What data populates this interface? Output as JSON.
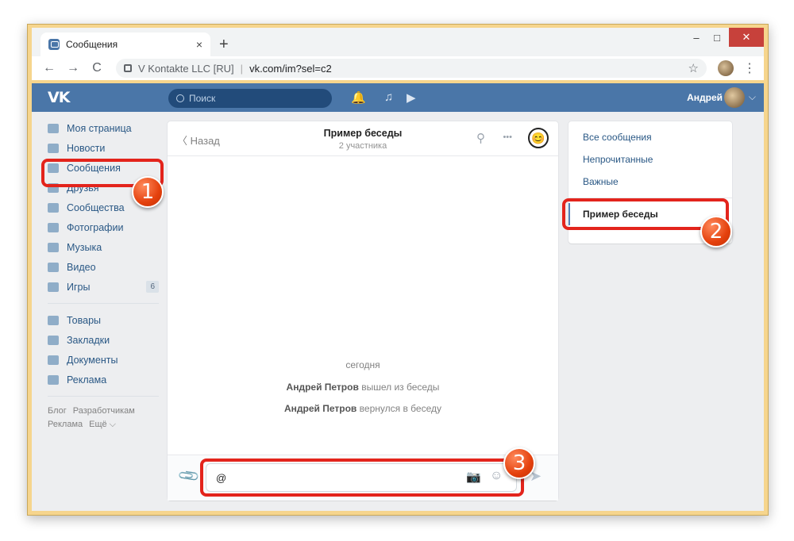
{
  "browser": {
    "tab_title": "Сообщения",
    "tab_close": "×",
    "new_tab": "+",
    "win_min": "–",
    "win_max": "□",
    "win_close": "✕",
    "back": "←",
    "forward": "→",
    "reload": "C",
    "site_name": "V Kontakte LLC [RU]",
    "url": "vk.com/im?sel=c2",
    "star": "☆",
    "menu": "⋮"
  },
  "vk_header": {
    "logo": "VK",
    "search_placeholder": "Поиск",
    "user_name": "Андрей",
    "bell": "🔔",
    "music": "♫",
    "play": "▶",
    "chevron": "⌵"
  },
  "left_nav": {
    "items": [
      {
        "label": "Моя страница"
      },
      {
        "label": "Новости"
      },
      {
        "label": "Сообщения"
      },
      {
        "label": "Друзья"
      },
      {
        "label": "Сообщества"
      },
      {
        "label": "Фотографии"
      },
      {
        "label": "Музыка"
      },
      {
        "label": "Видео"
      },
      {
        "label": "Игры",
        "badge": "6"
      }
    ],
    "items2": [
      {
        "label": "Товары"
      },
      {
        "label": "Закладки"
      },
      {
        "label": "Документы"
      },
      {
        "label": "Реклама"
      }
    ],
    "footer": [
      "Блог",
      "Разработчикам",
      "Реклама",
      "Ещё ⌵"
    ]
  },
  "chat": {
    "back_label": "Назад",
    "back_icon": "〈",
    "title": "Пример беседы",
    "subtitle": "2 участника",
    "search_icon": "⚲",
    "more_icon": "•••",
    "emoji": "😊",
    "day": "сегодня",
    "events": [
      {
        "name": "Андрей Петров",
        "text": "вышел из беседы"
      },
      {
        "name": "Андрей Петров",
        "text": "вернулся в беседу"
      }
    ],
    "input_value": "@",
    "attach_icon": "📎",
    "camera_icon": "📷",
    "smile_icon": "☺",
    "send_icon": "➤"
  },
  "right_nav": {
    "all": "Все сообщения",
    "unread": "Непрочитанные",
    "important": "Важные",
    "conversation": "Пример беседы"
  },
  "markers": [
    "1",
    "2",
    "3"
  ],
  "colors": {
    "vk_blue": "#4a76a8",
    "highlight_red": "#e3241c",
    "window_frame": "#f6d58d"
  }
}
